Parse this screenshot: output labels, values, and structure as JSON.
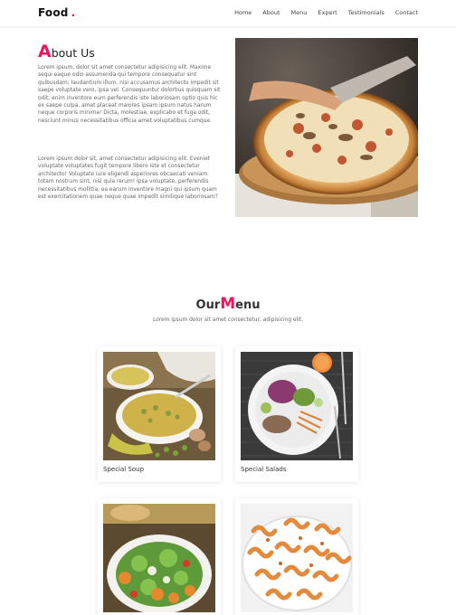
{
  "nav": {
    "brand": "Food",
    "brand_dot": ".",
    "links": [
      "Home",
      "About",
      "Menu",
      "Expert",
      "Testimonials",
      "Contact"
    ]
  },
  "about": {
    "title_initial": "A",
    "title_rest": "bout Us",
    "paragraph1": "Lorem ipsum, dolor sit amet consectetur adipisicing elit. Maxime sequi eaque odio assumenda qui tempore consequatur sint quibusdam; laudantium illum, nisi accusamus architecto impedit sit saepe voluptate vero, ipsa vel. Consequuntur dolorbus quisquam sit odit; enim inventore eum perferendis iste laboriosam optio quis hic ex saepe culpa, amet placeat maiores ipsam ipsum natus harum neque corporis minima! Dicta, molestiae, explicabo et fuga odit, nesciunt minus necessitatibus officia amet voluptatibus cumque.",
    "paragraph2": "Lorem ipsum dolor sit, amet consectetur adipisicing elit. Eveniet voluptate voluptates fugit tempore libero iste et consectetur architecto! Voluptate iure eligendi asperiores obcaecati veniam totam nostrum sint, nisi quia rerum! Ipsa voluptate, perferendis necessitatibus mollitia, ea earum inventore magni qui ipsum quam est exercitationem quae neque quae impedit similique laboriosam?"
  },
  "menu": {
    "title_prefix": "Our",
    "title_initial": "M",
    "title_rest": "enu",
    "subtitle": "Lorem ipsum dolor sit amet consectetur, adipisicing elit.",
    "items": [
      {
        "name": "Special Soup"
      },
      {
        "name": "Special Salads"
      },
      {
        "name": ""
      },
      {
        "name": ""
      }
    ]
  },
  "colors": {
    "accent": "#f0145a",
    "text": "#333333",
    "muted": "#666666"
  }
}
